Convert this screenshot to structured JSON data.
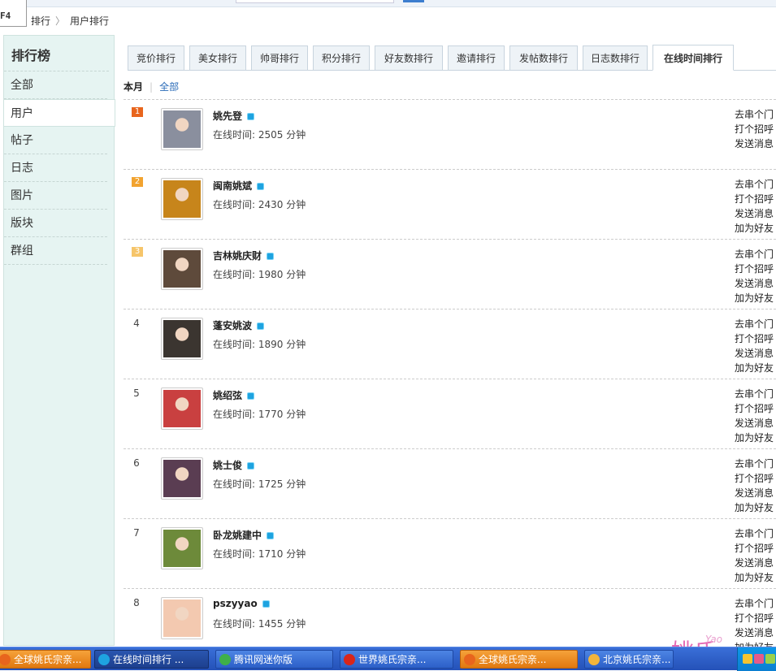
{
  "top": {
    "f4": "F4"
  },
  "breadcrumb": {
    "items": [
      "排行",
      "用户排行"
    ],
    "sep": "〉"
  },
  "sidebar": {
    "title": "排行榜",
    "items": [
      "全部",
      "用户",
      "帖子",
      "日志",
      "图片",
      "版块",
      "群组"
    ],
    "active": "用户"
  },
  "tabs": [
    {
      "label": "竞价排行",
      "active": false
    },
    {
      "label": "美女排行",
      "active": false
    },
    {
      "label": "帅哥排行",
      "active": false
    },
    {
      "label": "积分排行",
      "active": false
    },
    {
      "label": "好友数排行",
      "active": false
    },
    {
      "label": "邀请排行",
      "active": false
    },
    {
      "label": "发帖数排行",
      "active": false
    },
    {
      "label": "日志数排行",
      "active": false
    },
    {
      "label": "在线时间排行",
      "active": true
    }
  ],
  "filter": {
    "current": "本月",
    "sep": "|",
    "all": "全部"
  },
  "online_prefix": "在线时间: ",
  "online_unit": " 分钟",
  "users": [
    {
      "rank": "1",
      "name": "姚先登",
      "minutes": "2505",
      "avatar_color": "#8a8f9e",
      "actions": [
        "去串个门",
        "打个招呼",
        "发送消息"
      ]
    },
    {
      "rank": "2",
      "name": "闽南姚斌",
      "minutes": "2430",
      "avatar_color": "#c7851b",
      "actions": [
        "去串个门",
        "打个招呼",
        "发送消息",
        "加为好友"
      ]
    },
    {
      "rank": "3",
      "name": "吉林姚庆财",
      "minutes": "1980",
      "avatar_color": "#5e4a3b",
      "actions": [
        "去串个门",
        "打个招呼",
        "发送消息",
        "加为好友"
      ]
    },
    {
      "rank": "4",
      "name": "蓬安姚波",
      "minutes": "1890",
      "avatar_color": "#3b3530",
      "actions": [
        "去串个门",
        "打个招呼",
        "发送消息",
        "加为好友"
      ]
    },
    {
      "rank": "5",
      "name": "姚绍弦",
      "minutes": "1770",
      "avatar_color": "#c94040",
      "actions": [
        "去串个门",
        "打个招呼",
        "发送消息",
        "加为好友"
      ]
    },
    {
      "rank": "6",
      "name": "姚士俊",
      "minutes": "1725",
      "avatar_color": "#5a3d52",
      "actions": [
        "去串个门",
        "打个招呼",
        "发送消息",
        "加为好友"
      ]
    },
    {
      "rank": "7",
      "name": "卧龙姚建中",
      "minutes": "1710",
      "avatar_color": "#6d8a3a",
      "actions": [
        "去串个门",
        "打个招呼",
        "发送消息",
        "加为好友"
      ]
    },
    {
      "rank": "8",
      "name": "pszyyao",
      "minutes": "1455",
      "avatar_color": "#f3c9b0",
      "actions": [
        "去串个门",
        "打个招呼",
        "发送消息",
        "加为好友"
      ]
    }
  ],
  "taskbar": [
    {
      "label": "全球姚氏宗亲...",
      "style": "orange",
      "icon": "browser-icon",
      "icon_color": "#e8651d"
    },
    {
      "label": "在线时间排行 ...",
      "style": "active",
      "icon": "ie-icon",
      "icon_color": "#1ea3e0"
    },
    {
      "label": "腾讯网迷你版",
      "style": "blue",
      "icon": "qq-news-icon",
      "icon_color": "#3fb04a"
    },
    {
      "label": "世界姚氏宗亲...",
      "style": "blue",
      "icon": "red-circle-icon",
      "icon_color": "#d8261a"
    },
    {
      "label": "全球姚氏宗亲...",
      "style": "orange",
      "icon": "browser-icon",
      "icon_color": "#e8651d"
    },
    {
      "label": "北京姚氏宗亲...",
      "style": "blue",
      "icon": "qq-group-icon",
      "icon_color": "#f2b53b"
    }
  ],
  "watermark": {
    "text": "姚氏",
    "sub": "Yao"
  }
}
